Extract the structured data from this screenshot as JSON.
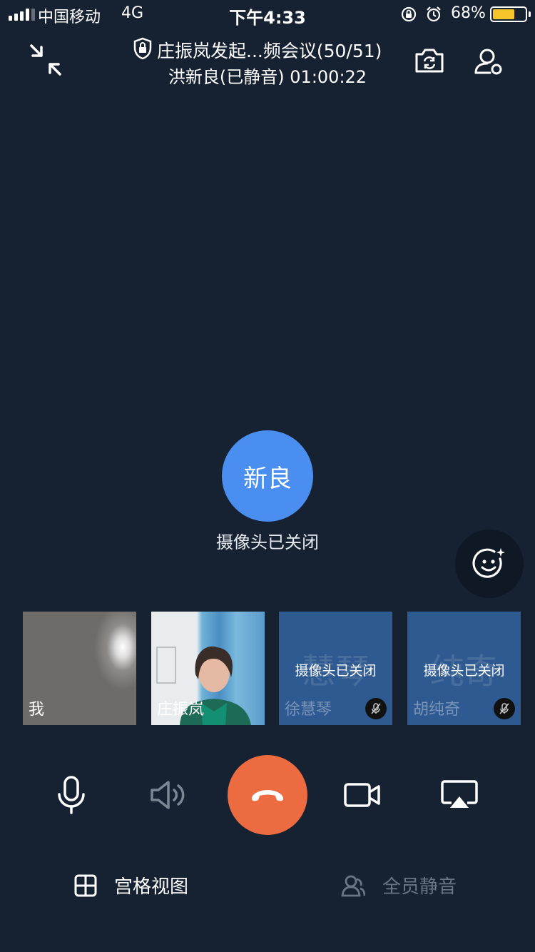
{
  "status_bar": {
    "carrier": "中国移动",
    "network": "4G",
    "time": "下午4:33",
    "battery_percent": "68%",
    "battery_level": 0.68
  },
  "header": {
    "title": "庄振岚发起...频会议(50/51)",
    "subtitle": "洪新良(已静音) 01:00:22",
    "icons": [
      "minimize-icon",
      "lock-shield-icon",
      "switch-camera-icon",
      "member-settings-icon"
    ]
  },
  "main_speaker": {
    "avatar_text": "新良",
    "status": "摄像头已关闭",
    "accent": "#4a8ef0"
  },
  "participants": [
    {
      "name": "我",
      "camera_off": false
    },
    {
      "name": "庄振岚",
      "camera_off": false
    },
    {
      "name": "徐慧琴",
      "watermark": "慧琴",
      "status": "摄像头已关闭",
      "muted": true
    },
    {
      "name": "胡纯奇",
      "watermark": "纯奇",
      "status": "摄像头已关闭",
      "muted": true
    }
  ],
  "controls": {
    "hangup_color": "#ec6b40",
    "items": [
      "microphone-icon",
      "speaker-icon",
      "hangup-icon",
      "video-camera-icon",
      "screen-share-icon"
    ]
  },
  "bottom_bar": {
    "grid_view_label": "宫格视图",
    "mute_all_label": "全员静音"
  }
}
